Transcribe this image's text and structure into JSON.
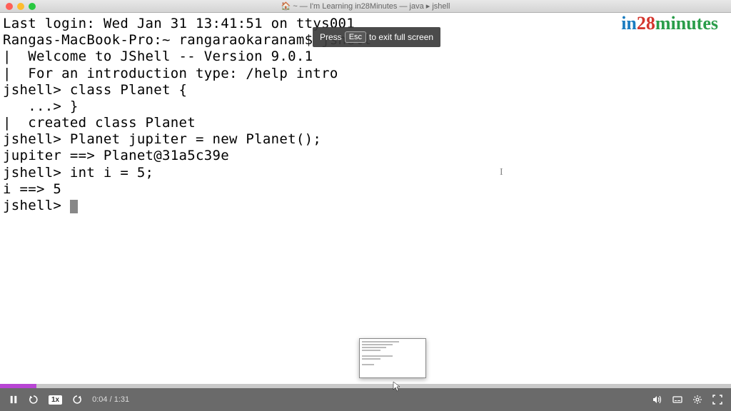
{
  "titlebar": {
    "title_prefix": "🏠 ~ — I'm Learning in28Minutes — java ▸ jshell"
  },
  "terminal": {
    "lines": [
      "Last login: Wed Jan 31 13:41:51 on ttys001",
      "Rangas-MacBook-Pro:~ rangaraokaranam$ jshell",
      "|  Welcome to JShell -- Version 9.0.1",
      "|  For an introduction type: /help intro",
      "",
      "jshell> class Planet {",
      "   ...> }",
      "|  created class Planet",
      "",
      "jshell> Planet jupiter = new Planet();",
      "jupiter ==> Planet@31a5c39e",
      "",
      "jshell> int i = 5;",
      "i ==> 5",
      "",
      "jshell> "
    ]
  },
  "hint": {
    "press": "Press",
    "key": "Esc",
    "rest": "to exit full screen"
  },
  "logo": {
    "in": "in",
    "num": "28",
    "rest": "minutes"
  },
  "player": {
    "speed": "1x",
    "time": "0:04 / 1:31"
  }
}
